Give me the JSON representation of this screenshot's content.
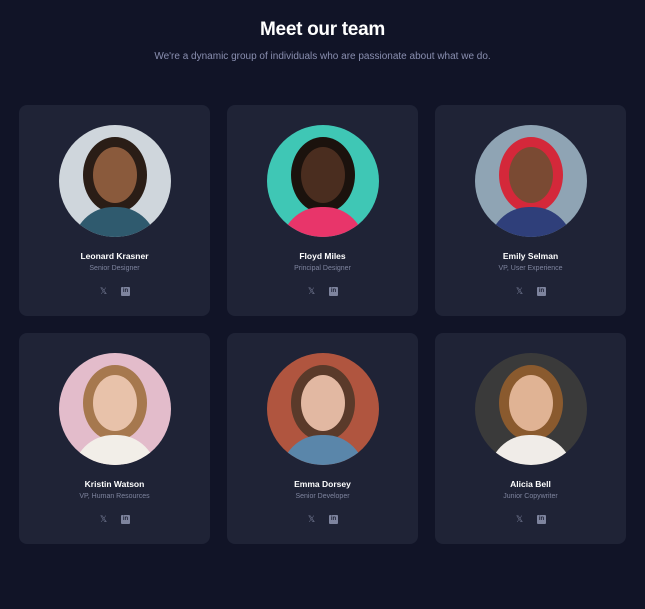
{
  "header": {
    "title": "Meet our team",
    "subtitle": "We're a dynamic group of individuals who are passionate about what we do."
  },
  "social_icons": {
    "x": "𝕏",
    "linkedin": "in"
  },
  "members": [
    {
      "name": "Leonard Krasner",
      "role": "Senior Designer",
      "bg": "#cfd6dc",
      "skin": "#8a5a3c",
      "hair": "#2a1d16",
      "shirt": "#2f5a6e"
    },
    {
      "name": "Floyd Miles",
      "role": "Principal Designer",
      "bg": "#3fc7b5",
      "skin": "#4a2d1f",
      "hair": "#1b120d",
      "shirt": "#e8356a"
    },
    {
      "name": "Emily Selman",
      "role": "VP, User Experience",
      "bg": "#8fa4b4",
      "skin": "#7a4a33",
      "hair": "#d4283a",
      "shirt": "#2f3f7a"
    },
    {
      "name": "Kristin Watson",
      "role": "VP, Human Resources",
      "bg": "#e3bccb",
      "skin": "#e8c2aa",
      "hair": "#a6784e",
      "shirt": "#f2eee8"
    },
    {
      "name": "Emma Dorsey",
      "role": "Senior Developer",
      "bg": "#b0553f",
      "skin": "#e2b8a2",
      "hair": "#5a3a2a",
      "shirt": "#5a86aa"
    },
    {
      "name": "Alicia Bell",
      "role": "Junior Copywriter",
      "bg": "#3a3a3a",
      "skin": "#e0b394",
      "hair": "#8a5a2e",
      "shirt": "#f0ece8"
    }
  ]
}
